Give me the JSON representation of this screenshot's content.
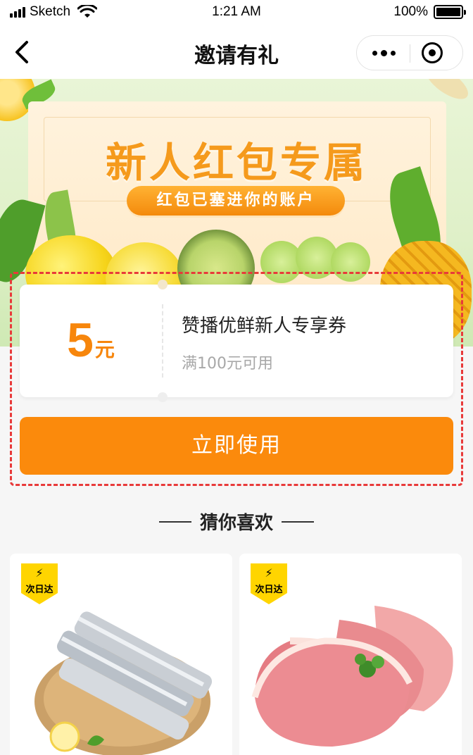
{
  "status_bar": {
    "carrier": "Sketch",
    "time": "1:21 AM",
    "battery": "100%"
  },
  "nav": {
    "title": "邀请有礼"
  },
  "banner": {
    "title": "新人红包专属",
    "subtitle": "红包已塞进你的账户"
  },
  "coupon": {
    "amount": "5",
    "unit": "元",
    "name": "赞播优鲜新人专享券",
    "condition": "满100元可用"
  },
  "use_button": "立即使用",
  "recommend": {
    "title": "猜你喜欢",
    "products": [
      {
        "badge_icon": "lightning-icon",
        "badge": "次日达",
        "image": "fish-fillet"
      },
      {
        "badge_icon": "lightning-icon",
        "badge": "次日达",
        "image": "pork-chops"
      }
    ]
  },
  "colors": {
    "accent": "#fb8a0c",
    "frame": "#e83a3a"
  }
}
